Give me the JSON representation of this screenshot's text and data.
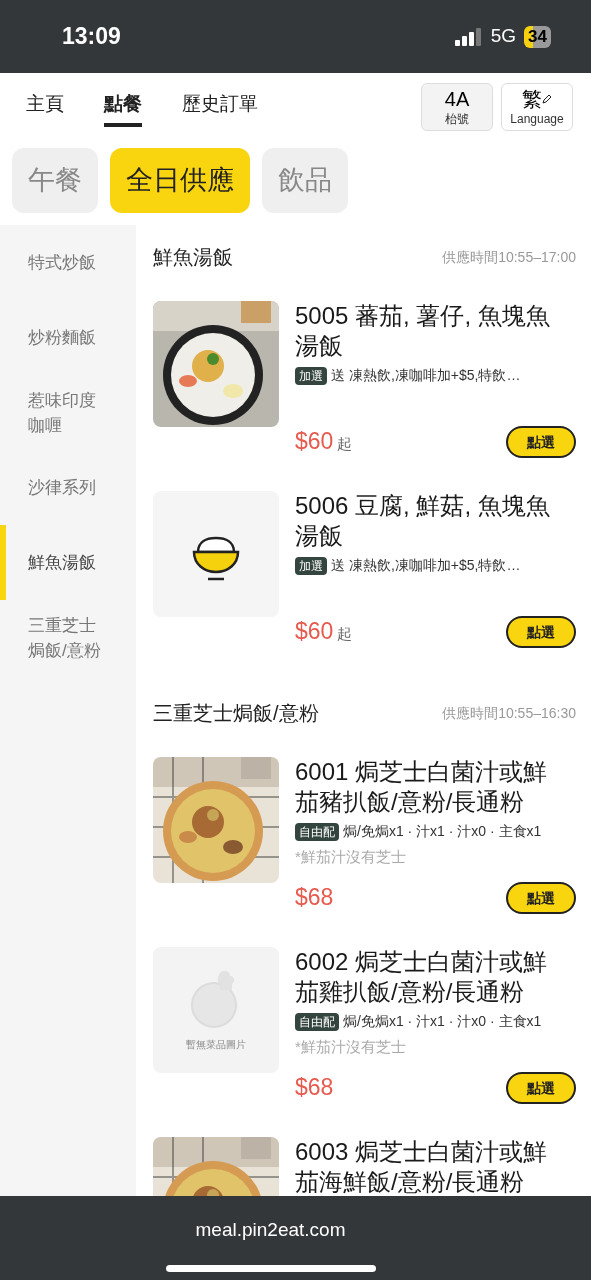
{
  "status_bar": {
    "time": "13:09",
    "network": "5G",
    "battery": "34"
  },
  "nav_tabs": [
    {
      "label": "主頁",
      "selected": false
    },
    {
      "label": "點餐",
      "selected": true
    },
    {
      "label": "歷史訂單",
      "selected": false
    }
  ],
  "table_button": {
    "value": "4A",
    "caption": "枱號"
  },
  "language_button": {
    "value": "繁",
    "caption": "Language"
  },
  "category_tabs": [
    {
      "label": "午餐",
      "selected": false
    },
    {
      "label": "全日供應",
      "selected": true
    },
    {
      "label": "飲品",
      "selected": false
    }
  ],
  "sidebar": {
    "items": [
      {
        "label": "特式炒飯",
        "selected": false
      },
      {
        "label": "炒粉麵飯",
        "selected": false
      },
      {
        "label": "惹味印度咖喱",
        "selected": false
      },
      {
        "label": "沙律系列",
        "selected": false
      },
      {
        "label": "鮮魚湯飯",
        "selected": true
      },
      {
        "label": "三重芝士焗飯/意粉",
        "selected": false
      }
    ]
  },
  "sections": [
    {
      "title": "鮮魚湯飯",
      "hours": "供應時間10:55–17:00",
      "items": [
        {
          "image": {
            "kind": "soup"
          },
          "name": "5005 蕃茄, 薯仔, 魚塊魚湯飯",
          "tag": "加選",
          "details": "送 凍熱飲,凍咖啡加+$5,特飲…",
          "price": "$60",
          "price_suffix": "起",
          "button": "點選"
        },
        {
          "image": {
            "kind": "bowl"
          },
          "name": "5006 豆腐, 鮮菇, 魚塊魚湯飯",
          "tag": "加選",
          "details": "送 凍熱飲,凍咖啡加+$5,特飲…",
          "price": "$60",
          "price_suffix": "起",
          "button": "點選"
        }
      ]
    },
    {
      "title": "三重芝士焗飯/意粉",
      "hours": "供應時間10:55–16:30",
      "items": [
        {
          "image": {
            "kind": "bake"
          },
          "name": "6001 焗芝士白菌汁或鮮茄豬扒飯/意粉/長通粉",
          "tag": "自由配",
          "details": "焗/免焗x1 · 汁x1 · 汁x0 · 主食x1",
          "note": "*鮮茄汁沒有芝士",
          "price": "$68",
          "button": "點選"
        },
        {
          "image": {
            "kind": "placeholder",
            "caption": "暫無菜品圖片"
          },
          "name": "6002 焗芝士白菌汁或鮮茄雞扒飯/意粉/長通粉",
          "tag": "自由配",
          "details": "焗/免焗x1 · 汁x1 · 汁x0 · 主食x1",
          "note": "*鮮茄汁沒有芝士",
          "price": "$68",
          "button": "點選"
        },
        {
          "image": {
            "kind": "bake"
          },
          "name": "6003 焗芝士白菌汁或鮮茄海鮮飯/意粉/長通粉"
        }
      ]
    }
  ],
  "browser_bar": {
    "url": "meal.pin2eat.com"
  }
}
